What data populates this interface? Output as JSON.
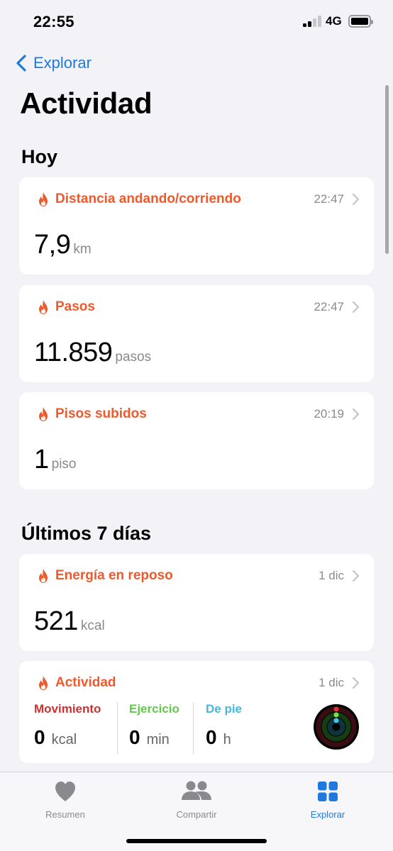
{
  "status": {
    "time": "22:55",
    "network": "4G"
  },
  "nav": {
    "back_label": "Explorar"
  },
  "page": {
    "title": "Actividad"
  },
  "sections": {
    "today": "Hoy",
    "last7": "Últimos 7 días"
  },
  "cards": [
    {
      "title": "Distancia andando/corriendo",
      "time": "22:47",
      "value": "7,9",
      "unit": "km"
    },
    {
      "title": "Pasos",
      "time": "22:47",
      "value": "11.859",
      "unit": "pasos"
    },
    {
      "title": "Pisos subidos",
      "time": "20:19",
      "value": "1",
      "unit": "piso"
    },
    {
      "title": "Energía en reposo",
      "time": "1 dic",
      "value": "521",
      "unit": "kcal"
    }
  ],
  "activity": {
    "title": "Actividad",
    "time": "1 dic",
    "move": {
      "label": "Movimiento",
      "value": "0",
      "unit": "kcal",
      "color": "#d0302f"
    },
    "exercise": {
      "label": "Ejercicio",
      "value": "0",
      "unit": "min",
      "color": "#62c94a"
    },
    "stand": {
      "label": "De pie",
      "value": "0",
      "unit": "h",
      "color": "#46b8d8"
    }
  },
  "tabs": [
    {
      "label": "Resumen",
      "icon": "heart-icon"
    },
    {
      "label": "Compartir",
      "icon": "people-icon"
    },
    {
      "label": "Explorar",
      "icon": "grid-icon"
    }
  ],
  "colors": {
    "accent": "#1f7ae0",
    "card_title": "#ec5a2e",
    "inactive_tab": "#8a8a8e"
  }
}
